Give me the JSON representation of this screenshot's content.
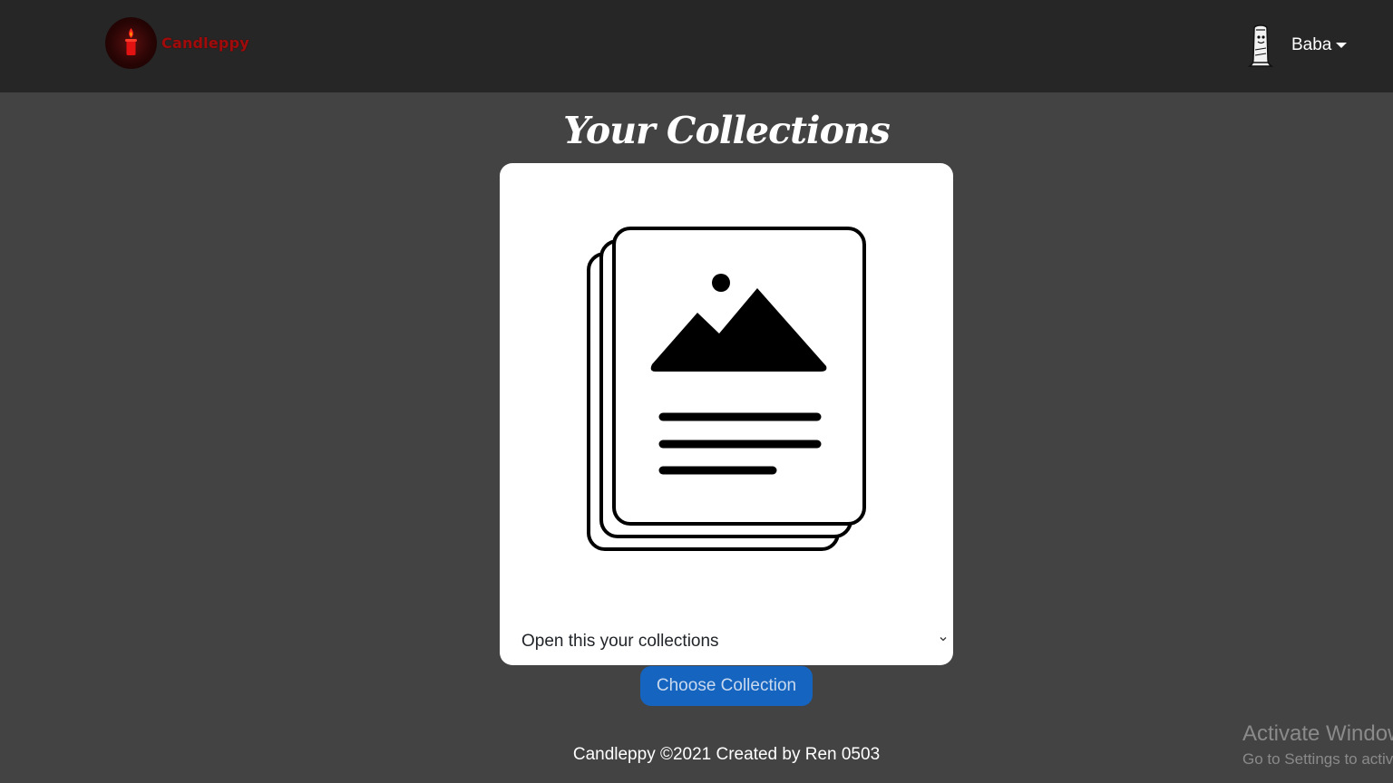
{
  "navbar": {
    "brand_name": "Candleppy",
    "user": {
      "name": "Baba"
    }
  },
  "main": {
    "title": "Your Collections",
    "select": {
      "selected": "Open this your collections"
    },
    "choose_button": "Choose Collection"
  },
  "footer": {
    "text": "Candleppy ©2021 Created by Ren 0503"
  },
  "os_watermark": {
    "title": "Activate Windows",
    "subtitle": "Go to Settings to activate Windows."
  },
  "icons": {
    "brand": "candle-logo-icon",
    "avatar": "user-avatar-icon",
    "dropdown": "caret-down-icon",
    "illustration": "collection-stack-icon",
    "select": "chevron-down-icon"
  },
  "colors": {
    "navbar_bg": "#262626",
    "page_bg": "#434343",
    "brand_text": "#a00c0c",
    "button_bg": "#1565c0"
  }
}
